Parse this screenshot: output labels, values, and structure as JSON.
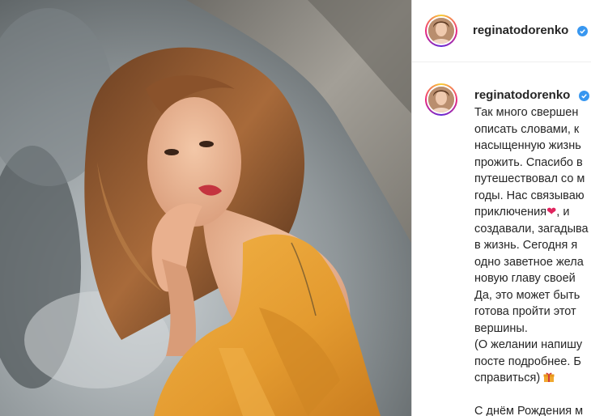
{
  "post": {
    "username": "reginatodorenko",
    "verified": true,
    "header_avatar_icon": "profile-avatar",
    "caption_lines": [
      "Так много свершен",
      "описать словами, к",
      "насыщенную жизнь",
      "прожить. Спасибо в",
      "путешествовал со м",
      "годы. Нас связываю",
      "приключения",
      ", и",
      "создавали, загадыва",
      "в жизнь. Сегодня я",
      "одно заветное жела",
      "новую главу своей",
      "Да, это может быть",
      "готова пройти этот",
      "вершины.",
      "(О желании напишу",
      "посте подробнее. Б",
      "справиться)",
      "С днём Рождения м"
    ],
    "emoji": {
      "heart": "❤",
      "gift": "gift-icon"
    }
  },
  "colors": {
    "photo_dress": "#e8a23a",
    "verified_blue": "#3897f0",
    "text": "#262626"
  }
}
